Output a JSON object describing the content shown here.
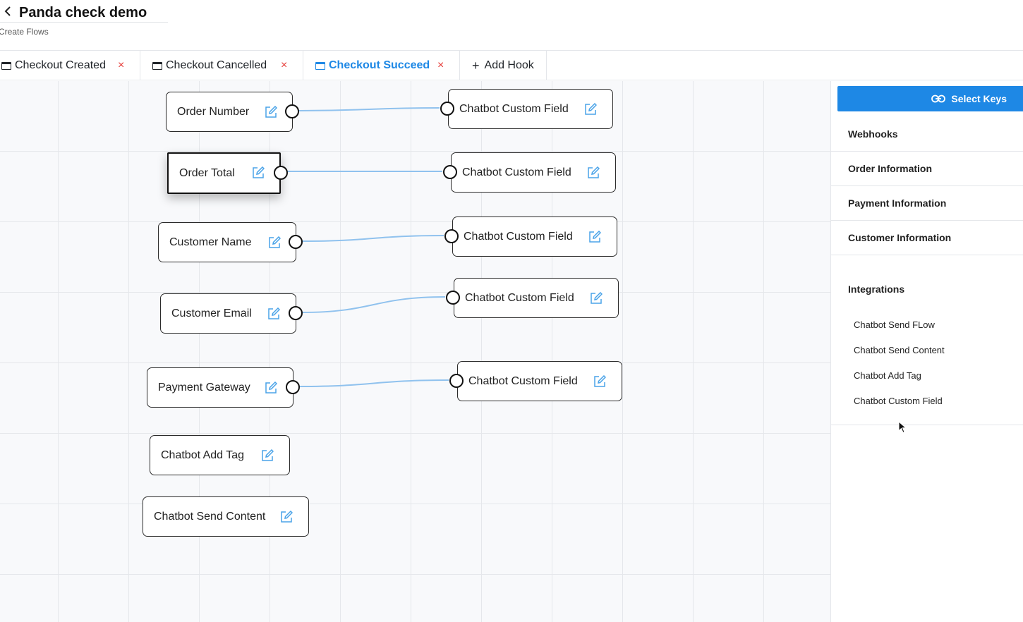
{
  "header": {
    "title": "Panda check demo",
    "subtitle": "Create Flows"
  },
  "tabs": [
    {
      "label": "Checkout Created",
      "closable": true,
      "active": false
    },
    {
      "label": "Checkout Cancelled",
      "closable": true,
      "active": false
    },
    {
      "label": "Checkout Succeed",
      "closable": true,
      "active": true
    },
    {
      "label": "Add Hook",
      "closable": false,
      "active": false
    }
  ],
  "tab_close_glyph": "×",
  "canvas": {
    "source_nodes": [
      {
        "label": "Order Number"
      },
      {
        "label": "Order Total",
        "selected": true
      },
      {
        "label": "Customer Name"
      },
      {
        "label": "Customer Email"
      },
      {
        "label": "Payment Gateway"
      },
      {
        "label": "Chatbot Add Tag"
      },
      {
        "label": "Chatbot Send Content"
      }
    ],
    "target_nodes": [
      {
        "label": "Chatbot Custom Field"
      },
      {
        "label": "Chatbot Custom Field"
      },
      {
        "label": "Chatbot Custom Field"
      },
      {
        "label": "Chatbot Custom Field"
      },
      {
        "label": "Chatbot Custom Field"
      }
    ],
    "connection_color": "#90c2ee"
  },
  "panel": {
    "select_keys_label": "Select Keys",
    "items": [
      "Webhooks",
      "Order Information",
      "Payment Information",
      "Customer Information"
    ],
    "integrations_title": "Integrations",
    "integrations": [
      "Chatbot Send FLow",
      "Chatbot Send Content",
      "Chatbot Add Tag",
      "Chatbot Custom Field"
    ]
  },
  "colors": {
    "accent": "#1e88e5",
    "close": "#e53935",
    "edit_icon": "#4aa3e8"
  }
}
